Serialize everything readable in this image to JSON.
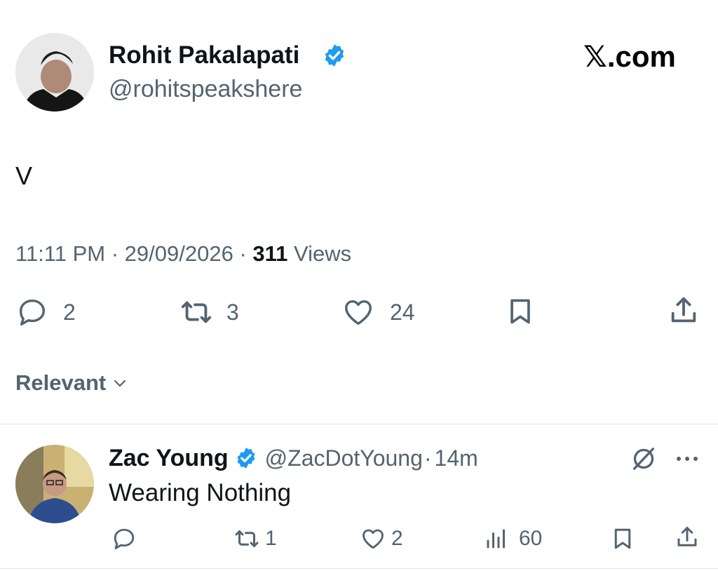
{
  "post": {
    "author_name": "Rohit Pakalapati",
    "author_handle": "@rohitspeakshere",
    "site_logo": "𝕏.com",
    "text": "V",
    "time": "11:11 PM",
    "sep1": "·",
    "date": "29/09/2026",
    "sep2": "·",
    "views_count": "311",
    "views_label": "Views",
    "actions": {
      "replies": "2",
      "reposts": "3",
      "likes": "24"
    }
  },
  "sort": {
    "label": "Relevant",
    "icon": "chevron-down-icon"
  },
  "reply": {
    "author_name": "Zac Young",
    "author_handle": "@ZacDotYoung",
    "sep": "·",
    "age": "14m",
    "text": "Wearing Nothing",
    "actions": {
      "replies": "",
      "reposts": "1",
      "likes": "2",
      "views": "60"
    }
  },
  "colors": {
    "verified": "#1d9bf0",
    "text_primary": "#0f1419",
    "text_secondary": "#536471"
  }
}
